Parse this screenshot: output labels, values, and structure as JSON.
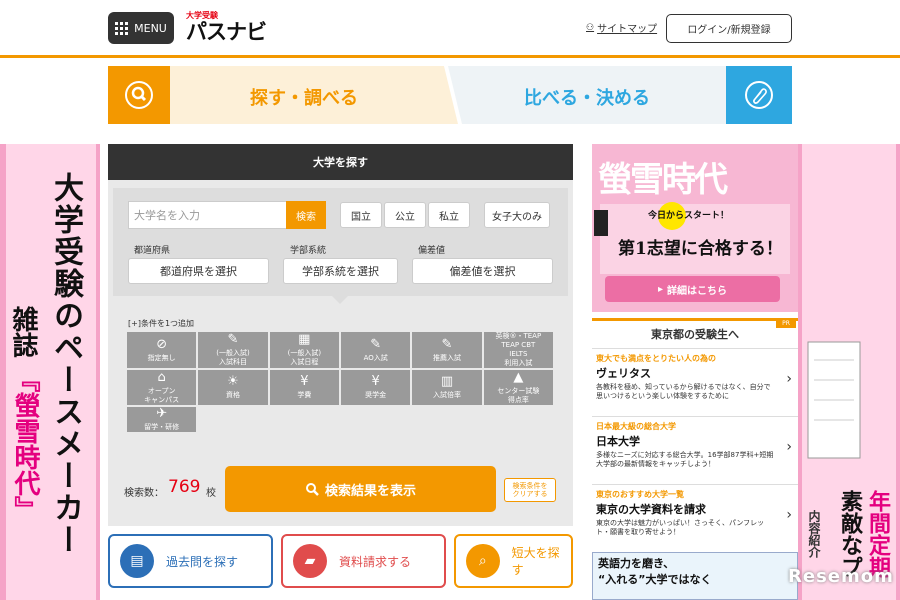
{
  "header": {
    "menu_label": "MENU",
    "logo_small": "大学受験",
    "logo_main": "パスナビ",
    "sitemap_label": "サイトマップ",
    "login_label": "ログイン/新規登録"
  },
  "tabs": {
    "search_label": "探す・調べる",
    "compare_label": "比べる・決める"
  },
  "left_ad": {
    "line1": "大学受験のペースメーカー",
    "line2": "雑誌",
    "line3": "『螢雪時代』"
  },
  "right_ad": {
    "line1": "年間定期",
    "line2": "素敵なプ",
    "line3": "内容紹介"
  },
  "panel": {
    "title": "大学を探す",
    "name_placeholder": "大学名を入力",
    "search_button": "検索",
    "type_chips": [
      "国立",
      "公立",
      "私立"
    ],
    "women_only": "女子大のみ",
    "prefecture_label": "都道府県",
    "prefecture_select": "都道府県を選択",
    "faculty_label": "学部系統",
    "faculty_select": "学部系統を選択",
    "deviation_label": "偏差値",
    "deviation_select": "偏差値を選択",
    "conditions_label": "[+]条件を1つ追加",
    "conditions": [
      {
        "icon": "⊘",
        "label": "指定無し"
      },
      {
        "icon": "✎",
        "label": "(一般入試)\n入試科目"
      },
      {
        "icon": "▦",
        "label": "(一般入試)\n入試日程"
      },
      {
        "icon": "✎",
        "label": "AO入試"
      },
      {
        "icon": "✎",
        "label": "推薦入試"
      },
      {
        "icon": "",
        "label": "英検®・TEAP\nTEAP CBT\nIELTS\n利用入試"
      },
      {
        "icon": "⌂",
        "label": "オープン\nキャンパス"
      },
      {
        "icon": "☀",
        "label": "資格"
      },
      {
        "icon": "¥",
        "label": "学費"
      },
      {
        "icon": "¥",
        "label": "奨学金"
      },
      {
        "icon": "▥",
        "label": "入試倍率"
      },
      {
        "icon": "▲",
        "label": "センター試験\n得点率"
      },
      {
        "icon": "✈",
        "label": "留学・研修"
      }
    ],
    "count_label": "検索数：",
    "count_value": "769",
    "count_unit": "校",
    "result_button": "検索結果を表示",
    "clear_button": "検索条件を\nクリアする"
  },
  "bottom_buttons": [
    {
      "label": "過去問を探す",
      "color": "#2c6fb7"
    },
    {
      "label": "資料請求する",
      "color": "#e04c4c"
    },
    {
      "label": "短大を探す",
      "color": "#f39800"
    }
  ],
  "book_ad": {
    "title": "螢雪時代",
    "slogan": "今日からスタート！",
    "slogan2": "第1志望に合格する！",
    "detail_button": "詳細はこちら"
  },
  "pr": {
    "header": "東京都の受験生へ",
    "badge": "PR",
    "items": [
      {
        "category": "東大でも満点をとりたい人の為の",
        "title": "ヴェリタス",
        "desc": "各教科を極め、知っているから解けるではなく、自分で思いつけるという楽しい体験をするために"
      },
      {
        "category": "日本最大級の総合大学",
        "title": "日本大学",
        "desc": "多様なニーズに対応する総合大学。16学部87学科+短期大学部の最新情報をキャッチしよう！"
      },
      {
        "category": "東京のおすすめ大学一覧",
        "title": "東京の大学資料を請求",
        "desc": "東京の大学は魅力がいっぱい！さっそく、パンフレット・願書を取り寄せよう！"
      }
    ]
  },
  "eng_ad": {
    "line1": "英語力を磨き、",
    "line2": "“入れる”大学ではなく"
  },
  "watermark": "Resemom"
}
